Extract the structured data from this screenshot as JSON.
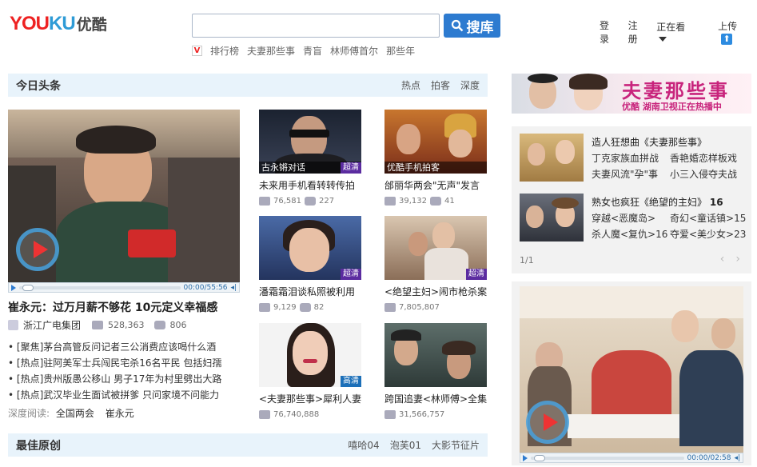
{
  "header": {
    "logo_text_a": "YOU",
    "logo_text_b": "KU",
    "logo_cn": "优酷",
    "search_value": "",
    "search_button": "搜库",
    "hotwords_icon": "V",
    "hotwords": [
      "排行榜",
      "夫妻那些事",
      "青盲",
      "林师傅首尔",
      "那些年"
    ],
    "nav": {
      "login": "登录",
      "register": "注册",
      "watching": "正在看",
      "upload": "上传"
    }
  },
  "headline_section": {
    "title": "今日头条",
    "links": [
      "热点",
      "拍客",
      "深度"
    ],
    "main_video": {
      "time": "00:00/55:56",
      "title": "崔永元：过万月薪不够花 10元定义幸福感",
      "channel": "浙江广电集团",
      "plays": "528,363",
      "comments": "806"
    },
    "headlines": [
      "• [聚焦]茅台高管反问记者三公消费应该喝什么酒",
      "• [热点]驻阿美军士兵闯民宅杀16名平民 包括妇孺",
      "• [热点]贵州版愚公移山 男子17年为村里劈出大路",
      "• [热点]武汉毕业生面试被拼爹 只问家境不问能力"
    ],
    "deep_read_label": "深度阅读:",
    "deep_read_items": [
      "全国两会",
      "崔永元"
    ]
  },
  "thumbs": [
    {
      "cap": "古永锵对话",
      "hd": "超清",
      "title": "未来用手机看转转传拍",
      "plays": "76,581",
      "comments": "227"
    },
    {
      "cap": "优酷手机拍客",
      "hd": "",
      "title": "邰丽华两会\"无声\"发言",
      "plays": "39,132",
      "comments": "41"
    },
    {
      "cap": "",
      "hd": "超清",
      "title": "潘霜霜泪谈私照被利用",
      "plays": "9,129",
      "comments": "82"
    },
    {
      "cap": "",
      "hd": "超清",
      "title": "<绝望主妇>闹市枪杀案",
      "plays": "7,805,807",
      "comments": ""
    },
    {
      "cap": "",
      "hd": "高清",
      "title": "<夫妻那些事>犀利人妻",
      "plays": "76,740,888",
      "comments": ""
    },
    {
      "cap": "",
      "hd": "",
      "title": "跨国追妻<林师傅>全集",
      "plays": "31,566,757",
      "comments": ""
    }
  ],
  "original_section": {
    "title": "最佳原创",
    "links": [
      "嘻哈04",
      "泡芙01",
      "大影节征片"
    ]
  },
  "banner": {
    "title": "夫妻那些事",
    "subtitle": "优酷 湖南卫视正在热播中"
  },
  "recommend": [
    {
      "title": "造人狂想曲《夫妻那些事》",
      "extra": "",
      "links": [
        "丁克家族血拼战",
        "香艳婚恋样板戏",
        "夫妻风流\"孕\"事",
        "小三入侵夺夫战"
      ]
    },
    {
      "title": "熟女也疯狂《绝望的主妇》",
      "extra": "16",
      "links": [
        "穿越<恶魔岛>",
        "奇幻<童话镇>15",
        "杀人魔<复仇>16",
        "夺爱<美少女>23"
      ]
    }
  ],
  "pager": "1/1",
  "side_video": {
    "time": "00:00/02:58"
  }
}
